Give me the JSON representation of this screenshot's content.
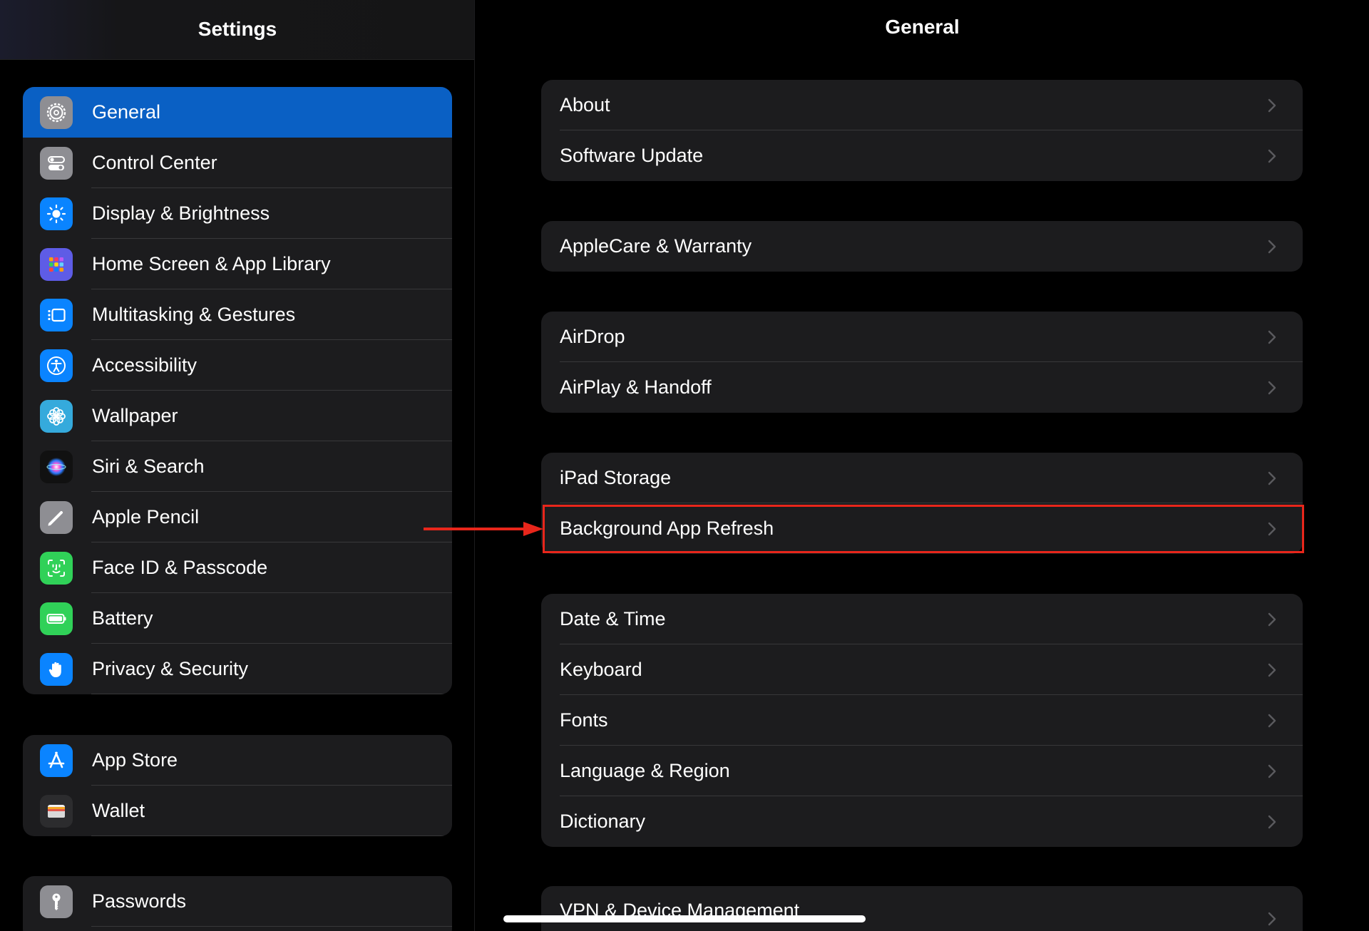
{
  "sidebar": {
    "title": "Settings",
    "groups": [
      {
        "items": [
          {
            "label": "General",
            "icon": "gear-icon",
            "color": "#8e8e93",
            "selected": true
          },
          {
            "label": "Control Center",
            "icon": "toggles-icon",
            "color": "#8e8e93"
          },
          {
            "label": "Display & Brightness",
            "icon": "sun-icon",
            "color": "#0a84ff"
          },
          {
            "label": "Home Screen & App Library",
            "icon": "app-grid-icon",
            "color": "#5e5ce6"
          },
          {
            "label": "Multitasking & Gestures",
            "icon": "multitasking-icon",
            "color": "#0a84ff"
          },
          {
            "label": "Accessibility",
            "icon": "accessibility-icon",
            "color": "#0a84ff"
          },
          {
            "label": "Wallpaper",
            "icon": "flower-icon",
            "color": "#35aadc"
          },
          {
            "label": "Siri & Search",
            "icon": "siri-icon",
            "color": "#000000"
          },
          {
            "label": "Apple Pencil",
            "icon": "pencil-icon",
            "color": "#8e8e93"
          },
          {
            "label": "Face ID & Passcode",
            "icon": "face-id-icon",
            "color": "#30d158"
          },
          {
            "label": "Battery",
            "icon": "battery-icon",
            "color": "#30d158"
          },
          {
            "label": "Privacy & Security",
            "icon": "hand-icon",
            "color": "#0a84ff"
          }
        ]
      },
      {
        "items": [
          {
            "label": "App Store",
            "icon": "app-store-icon",
            "color": "#0a84ff"
          },
          {
            "label": "Wallet",
            "icon": "wallet-icon",
            "color": "#1c1c1e"
          }
        ]
      },
      {
        "items": [
          {
            "label": "Passwords",
            "icon": "key-icon",
            "color": "#8e8e93"
          }
        ]
      }
    ]
  },
  "detail": {
    "title": "General",
    "groups": [
      {
        "rows": [
          {
            "label": "About"
          },
          {
            "label": "Software Update"
          }
        ]
      },
      {
        "rows": [
          {
            "label": "AppleCare & Warranty"
          }
        ]
      },
      {
        "rows": [
          {
            "label": "AirDrop"
          },
          {
            "label": "AirPlay & Handoff"
          }
        ]
      },
      {
        "rows": [
          {
            "label": "iPad Storage"
          },
          {
            "label": "Background App Refresh",
            "highlighted": true
          }
        ]
      },
      {
        "rows": [
          {
            "label": "Date & Time"
          },
          {
            "label": "Keyboard"
          },
          {
            "label": "Fonts"
          },
          {
            "label": "Language & Region"
          },
          {
            "label": "Dictionary"
          }
        ]
      },
      {
        "rows": [
          {
            "label": "VPN & Device Management"
          }
        ]
      }
    ]
  },
  "annotation": {
    "color": "#e8261b",
    "target": "Background App Refresh"
  },
  "colors": {
    "selected_row": "#0a60c4",
    "group_background": "#1c1c1e",
    "separator": "#38383a",
    "chevron": "#5a5a5e"
  }
}
